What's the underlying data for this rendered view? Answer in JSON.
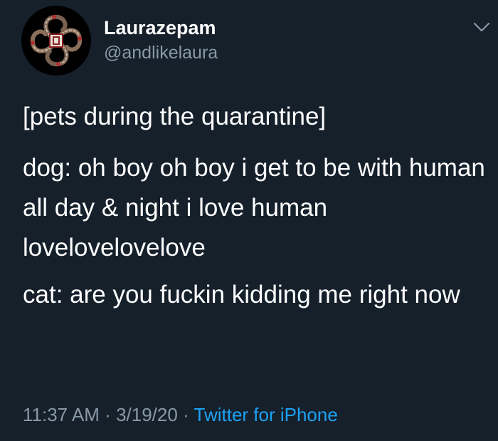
{
  "author": {
    "display_name": "Laurazepam",
    "handle": "@andlikelaura",
    "avatar_icon": "coiled-snakes-avatar"
  },
  "menu": {
    "icon": "chevron-down-icon"
  },
  "tweet": {
    "paragraphs": [
      "[pets during the quarantine]",
      "dog: oh boy oh boy i get to be with human all day & night i love human lovelovelovelove",
      "cat: are you fuckin kidding me right now"
    ]
  },
  "meta": {
    "time": "11:37 AM",
    "separator": "·",
    "date": "3/19/20",
    "source": "Twitter for iPhone"
  },
  "colors": {
    "background": "#15202b",
    "text_primary": "#ffffff",
    "text_secondary": "#8899a6",
    "link": "#1da1f2"
  }
}
